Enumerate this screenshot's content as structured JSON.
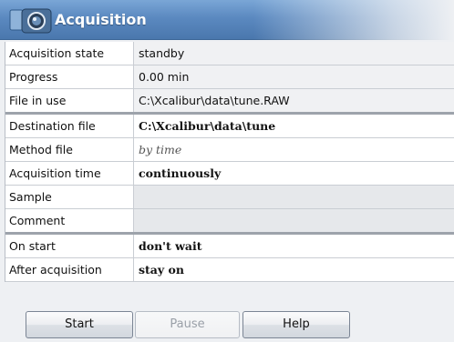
{
  "window": {
    "title": "Acquisition",
    "icon": "camera-icon",
    "accent_color": "#5b89c0"
  },
  "section1": [
    {
      "label": "Acquisition state",
      "value": "standby"
    },
    {
      "label": "Progress",
      "value": "0.00 min"
    },
    {
      "label": "File in use",
      "value": "C:\\Xcalibur\\data\\tune.RAW"
    }
  ],
  "section2": [
    {
      "label": "Destination file",
      "value": "C:\\Xcalibur\\data\\tune"
    },
    {
      "label": "Method file",
      "value": "by time"
    },
    {
      "label": "Acquisition time",
      "value": "continuously"
    },
    {
      "label": "Sample",
      "value": ""
    },
    {
      "label": "Comment",
      "value": ""
    }
  ],
  "section3": [
    {
      "label": "On start",
      "value": "don't wait"
    },
    {
      "label": "After acquisition",
      "value": "stay on"
    }
  ],
  "buttons": {
    "start": "Start",
    "pause": "Pause",
    "help": "Help"
  }
}
